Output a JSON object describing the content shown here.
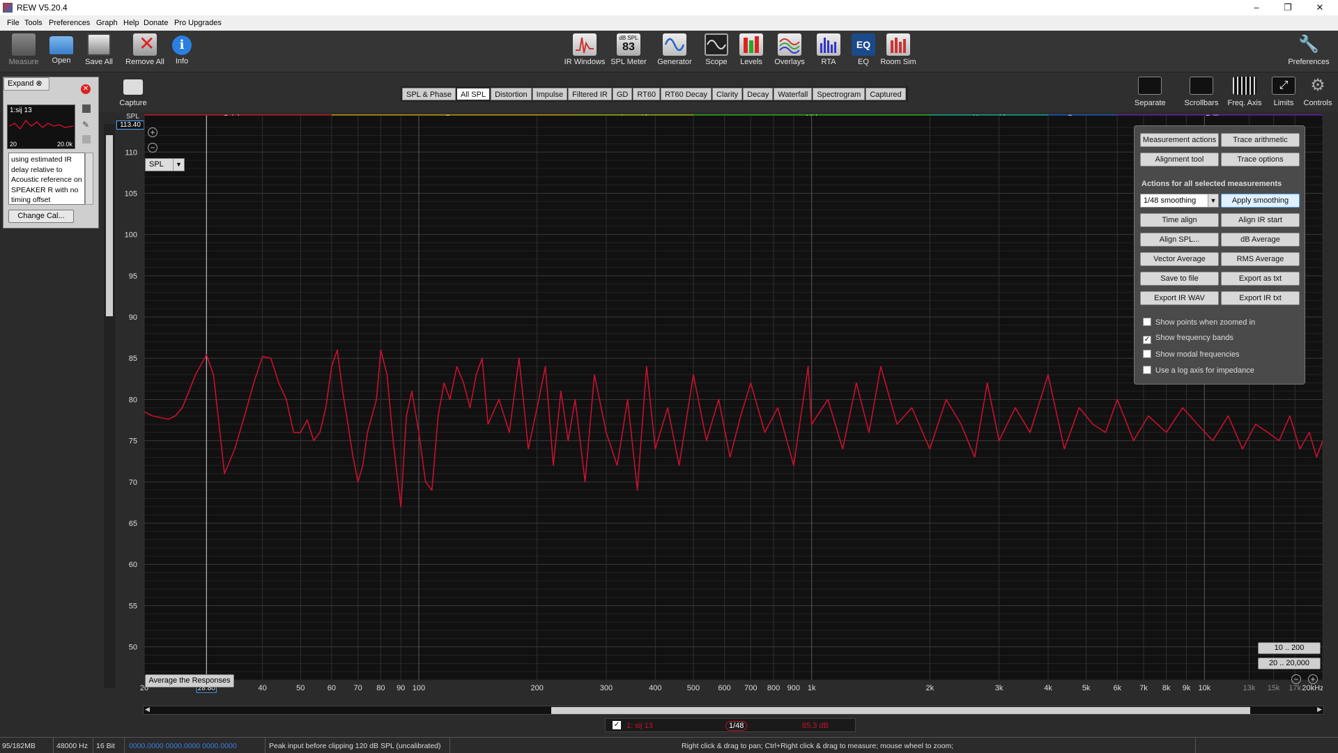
{
  "window": {
    "title": "REW V5.20.4",
    "minimize": "–",
    "restore": "❐",
    "close": "✕"
  },
  "menu": [
    "File",
    "Tools",
    "Preferences",
    "Graph",
    "Help",
    "Donate",
    "Pro Upgrades"
  ],
  "toolbar": {
    "left": [
      {
        "label": "Measure",
        "icon": "measure-icon",
        "color": "#777"
      },
      {
        "label": "Open",
        "icon": "open-folder-icon",
        "color": "#5a9ee0"
      },
      {
        "label": "Save All",
        "icon": "save-all-icon",
        "color": "#ddd"
      },
      {
        "label": "Remove All",
        "icon": "remove-all-icon",
        "color": "#c44"
      },
      {
        "label": "Info",
        "icon": "info-icon",
        "color": "#2a7fe0"
      }
    ],
    "center": [
      {
        "label": "IR Windows",
        "icon": "ir-windows-icon"
      },
      {
        "label": "SPL Meter",
        "icon": "spl-meter-icon",
        "badge_top": "dB SPL",
        "badge_value": "83"
      },
      {
        "label": "Generator",
        "icon": "generator-icon"
      },
      {
        "label": "Scope",
        "icon": "scope-icon"
      },
      {
        "label": "Levels",
        "icon": "levels-icon"
      },
      {
        "label": "Overlays",
        "icon": "overlays-icon"
      },
      {
        "label": "RTA",
        "icon": "rta-icon"
      },
      {
        "label": "EQ",
        "icon": "eq-icon",
        "text": "EQ"
      },
      {
        "label": "Room Sim",
        "icon": "room-sim-icon"
      }
    ],
    "preferences": "Preferences",
    "capture": "Capture",
    "right": [
      "Separate",
      "Scrollbars",
      "Freq. Axis",
      "Limits",
      "Controls"
    ]
  },
  "tabs": [
    "SPL & Phase",
    "All SPL",
    "Distortion",
    "Impulse",
    "Filtered IR",
    "GD",
    "RT60",
    "RT60 Decay",
    "Clarity",
    "Decay",
    "Waterfall",
    "Spectrogram",
    "Captured"
  ],
  "active_tab": "All SPL",
  "left_panel": {
    "expand": "Expand",
    "measurement_name": "1:sij 13",
    "thumb_low": "20",
    "thumb_high": "20.0k",
    "notes": "using estimated IR delay relative to Acoustic reference on SPEAKER R with no timing offset",
    "change_cal": "Change Cal..."
  },
  "graph": {
    "y_unit": "SPL",
    "y_cursor": "113.40",
    "selector": "SPL",
    "x_cursor": "28.80",
    "average_button": "Average the Responses",
    "range_buttons": [
      "10 .. 200",
      "20 .. 20,000"
    ]
  },
  "bands": [
    {
      "name": "Sub bass",
      "from": 20,
      "to": 60,
      "color": "#9b1c1c"
    },
    {
      "name": "Bass",
      "from": 60,
      "to": 250,
      "color": "#9a7c12"
    },
    {
      "name": "Low mid",
      "from": 250,
      "to": 500,
      "color": "#7a8c12"
    },
    {
      "name": "Mid",
      "from": 500,
      "to": 2000,
      "color": "#2a8a18"
    },
    {
      "name": "Upper mid",
      "from": 2000,
      "to": 4000,
      "color": "#148a6a"
    },
    {
      "name": "Presence",
      "from": 4000,
      "to": 6000,
      "color": "#1c4a9a"
    },
    {
      "name": "Brilliance",
      "from": 6000,
      "to": 20000,
      "color": "#5a1c8a"
    }
  ],
  "chart_data": {
    "type": "line",
    "xlabel": "",
    "ylabel": "SPL",
    "xscale": "log",
    "xlim": [
      20,
      20000
    ],
    "ylim": [
      46,
      113.4
    ],
    "y_ticks": [
      50,
      55,
      60,
      65,
      70,
      75,
      80,
      85,
      90,
      95,
      100,
      105,
      110
    ],
    "x_ticks": [
      {
        "v": 20,
        "l": "20"
      },
      {
        "v": 40,
        "l": "40"
      },
      {
        "v": 50,
        "l": "50"
      },
      {
        "v": 60,
        "l": "60"
      },
      {
        "v": 70,
        "l": "70"
      },
      {
        "v": 80,
        "l": "80"
      },
      {
        "v": 90,
        "l": "90"
      },
      {
        "v": 100,
        "l": "100"
      },
      {
        "v": 200,
        "l": "200"
      },
      {
        "v": 300,
        "l": "300"
      },
      {
        "v": 400,
        "l": "400"
      },
      {
        "v": 500,
        "l": "500"
      },
      {
        "v": 600,
        "l": "600"
      },
      {
        "v": 700,
        "l": "700"
      },
      {
        "v": 800,
        "l": "800"
      },
      {
        "v": 900,
        "l": "900"
      },
      {
        "v": 1000,
        "l": "1k"
      },
      {
        "v": 2000,
        "l": "2k"
      },
      {
        "v": 3000,
        "l": "3k"
      },
      {
        "v": 4000,
        "l": "4k"
      },
      {
        "v": 5000,
        "l": "5k"
      },
      {
        "v": 6000,
        "l": "6k"
      },
      {
        "v": 7000,
        "l": "7k"
      },
      {
        "v": 8000,
        "l": "8k"
      },
      {
        "v": 9000,
        "l": "9k"
      },
      {
        "v": 10000,
        "l": "10k"
      },
      {
        "v": 13000,
        "l": "13k"
      },
      {
        "v": 15000,
        "l": "15k"
      },
      {
        "v": 17000,
        "l": "17k"
      },
      {
        "v": 20000,
        "l": "20kHz"
      }
    ],
    "grid": true,
    "series": [
      {
        "name": "1: sij 13",
        "color": "#c8102e",
        "x": [
          20,
          21,
          22,
          23,
          24,
          25,
          26,
          27,
          28.8,
          30,
          31,
          32,
          34,
          36,
          38,
          40,
          42,
          44,
          46,
          48,
          50,
          52,
          54,
          56,
          58,
          60,
          62,
          64,
          66,
          68,
          70,
          72,
          74,
          76,
          78,
          80,
          83,
          86,
          90,
          93,
          96,
          100,
          104,
          108,
          112,
          116,
          120,
          125,
          130,
          135,
          140,
          145,
          150,
          160,
          170,
          180,
          190,
          200,
          210,
          220,
          230,
          240,
          250,
          265,
          280,
          300,
          320,
          340,
          360,
          380,
          400,
          430,
          460,
          500,
          540,
          580,
          620,
          660,
          700,
          760,
          820,
          900,
          980,
          1000,
          1100,
          1200,
          1300,
          1400,
          1500,
          1650,
          1800,
          2000,
          2200,
          2400,
          2600,
          2800,
          3000,
          3300,
          3600,
          4000,
          4400,
          4800,
          5200,
          5600,
          6000,
          6600,
          7200,
          8000,
          8800,
          9600,
          10500,
          11500,
          12500,
          13500,
          14500,
          15500,
          16500,
          17500,
          18500,
          19300,
          20000
        ],
        "y": [
          78.5,
          78,
          77.8,
          77.6,
          78,
          79,
          81,
          83,
          85.4,
          83,
          77,
          71,
          74,
          78,
          82,
          85.2,
          85,
          82,
          80,
          76,
          76,
          77.5,
          75,
          76,
          79,
          84,
          86,
          81,
          77,
          73,
          70,
          72,
          76,
          78,
          80,
          86,
          83,
          75,
          67,
          78,
          81,
          76,
          70,
          69,
          78,
          82,
          80,
          84,
          82,
          79,
          83,
          85,
          77,
          80,
          76,
          85,
          74,
          79,
          84,
          72,
          81,
          75,
          80,
          70,
          83,
          76,
          72,
          80,
          69,
          84,
          74,
          79,
          72,
          83,
          75,
          80,
          73,
          78,
          82,
          76,
          79,
          72,
          84,
          77,
          80,
          74,
          82,
          76,
          84,
          77,
          79,
          74,
          80,
          77,
          73,
          82,
          75,
          79,
          76,
          83,
          74,
          79,
          77,
          76,
          80,
          75,
          78,
          76,
          79,
          77,
          75,
          78,
          74,
          77,
          76,
          75,
          78,
          74,
          76,
          73,
          75
        ]
      }
    ]
  },
  "controls": {
    "buttons_top": [
      "Measurement actions",
      "Trace arithmetic",
      "Alignment tool",
      "Trace options"
    ],
    "header": "Actions for all selected measurements",
    "smoothing": "1/48 smoothing",
    "apply": "Apply smoothing",
    "buttons": [
      "Time align",
      "Align IR start",
      "Align SPL...",
      "dB Average",
      "Vector Average",
      "RMS Average",
      "Save to file",
      "Export as txt",
      "Export IR WAV",
      "Export IR txt"
    ],
    "checkboxes": [
      {
        "label": "Show points when zoomed in",
        "checked": false
      },
      {
        "label": "Show frequency bands",
        "checked": true
      },
      {
        "label": "Show modal frequencies",
        "checked": false
      },
      {
        "label": "Use a log axis for impedance",
        "checked": false
      }
    ]
  },
  "legend": {
    "name": "1: sij 13",
    "smoothing": "1/48",
    "value": "85.3 dB"
  },
  "status": {
    "memory": "95/182MB",
    "rate": "48000 Hz",
    "bits": "16 Bit",
    "levels": "0000.0000  0000.0000  0000.0000",
    "peak": "Peak input before clipping 120 dB SPL (uncalibrated)",
    "hint": "Right click & drag to pan; Ctrl+Right click & drag to measure; mouse wheel to zoom;"
  }
}
